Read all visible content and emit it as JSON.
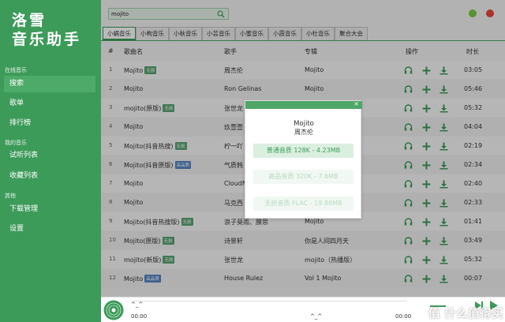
{
  "app": {
    "logo_line1": "洛雪",
    "logo_line2": "音乐助手",
    "accent": "#3d9b5a"
  },
  "sidebar": {
    "section_online": "在线音乐",
    "section_mine": "我的音乐",
    "section_other": "其他",
    "items": [
      {
        "label": "搜索",
        "active": true
      },
      {
        "label": "歌单"
      },
      {
        "label": "排行榜"
      },
      {
        "label": "试听列表"
      },
      {
        "label": "收藏列表"
      },
      {
        "label": "下载管理"
      },
      {
        "label": "设置"
      }
    ]
  },
  "search": {
    "value": "mojito",
    "icon": "search-icon"
  },
  "window_controls": {
    "minimize_color": "#7cc943",
    "close_color": "#e9463f"
  },
  "tabs": [
    "小蜗音乐",
    "小枸音乐",
    "小秋音乐",
    "小芸音乐",
    "小蜜音乐",
    "小霞音乐",
    "小杜音乐",
    "聚合大会"
  ],
  "table": {
    "headers": {
      "num": "#",
      "song": "歌曲名",
      "artist": "歌手",
      "album": "专辑",
      "actions": "操作",
      "duration": "时长"
    },
    "rows": [
      {
        "num": "1",
        "song": "Mojito",
        "tag": "无损",
        "tag_type": "lossless",
        "artist": "周杰伦",
        "album": "Mojito",
        "duration": "03:05"
      },
      {
        "num": "2",
        "song": "Mojito",
        "tag": "",
        "tag_type": "",
        "artist": "Ron Gelinas",
        "album": "Mojito",
        "duration": "05:46"
      },
      {
        "num": "3",
        "song": "mojito(原版)",
        "tag": "无损",
        "tag_type": "lossless",
        "artist": "张世龙",
        "album": "",
        "duration": "05:32"
      },
      {
        "num": "4",
        "song": "Mojito",
        "tag": "",
        "tag_type": "",
        "artist": "玖壹壹",
        "album": "",
        "duration": "04:04"
      },
      {
        "num": "5",
        "song": "Mojito(抖音热搜)",
        "tag": "无损",
        "tag_type": "lossless",
        "artist": "柠一吖",
        "album": "",
        "duration": "02:19"
      },
      {
        "num": "6",
        "song": "Mojito(抖音原版)",
        "tag": "高品质",
        "tag_type": "hq",
        "artist": "气质韩",
        "album": "",
        "duration": "02:34"
      },
      {
        "num": "7",
        "song": "Mojito",
        "tag": "",
        "tag_type": "",
        "artist": "CloudN",
        "album": "",
        "duration": "02:40"
      },
      {
        "num": "8",
        "song": "Mojito",
        "tag": "",
        "tag_type": "",
        "artist": "马克西",
        "album": "",
        "duration": "02:33"
      },
      {
        "num": "9",
        "song": "Mojito(抖音热搜版)",
        "tag": "无损",
        "tag_type": "lossless",
        "artist": "浪子莫雨、膜思",
        "album": "Mojito",
        "duration": "01:41"
      },
      {
        "num": "10",
        "song": "Mojito(原版)",
        "tag": "无损",
        "tag_type": "lossless",
        "artist": "诗景轩",
        "album": "你是人间四月天",
        "duration": "03:49"
      },
      {
        "num": "11",
        "song": "mojito(新版)",
        "tag": "无损",
        "tag_type": "lossless",
        "artist": "张世龙",
        "album": "mojito（热播版）",
        "duration": "05:32"
      },
      {
        "num": "12",
        "song": "Mojito",
        "tag": "高品质",
        "tag_type": "hq",
        "artist": "House Rulez",
        "album": "Vol 1 Mojito",
        "duration": "00:07"
      }
    ]
  },
  "dialog": {
    "title": "Mojito",
    "artist": "周杰伦",
    "options": [
      {
        "label": "普通音质 128K - 4.23MB",
        "enabled": true
      },
      {
        "label": "高品音质 320K - 7.6MB",
        "enabled": false
      },
      {
        "label": "无损音质 FLAC - 19.88MB",
        "enabled": false
      }
    ],
    "close_icon": "×"
  },
  "player": {
    "title": "^_^",
    "time_current": "00:00",
    "center_text": "^_^",
    "time_total": "00:00"
  },
  "watermark": "值 什么值得买"
}
